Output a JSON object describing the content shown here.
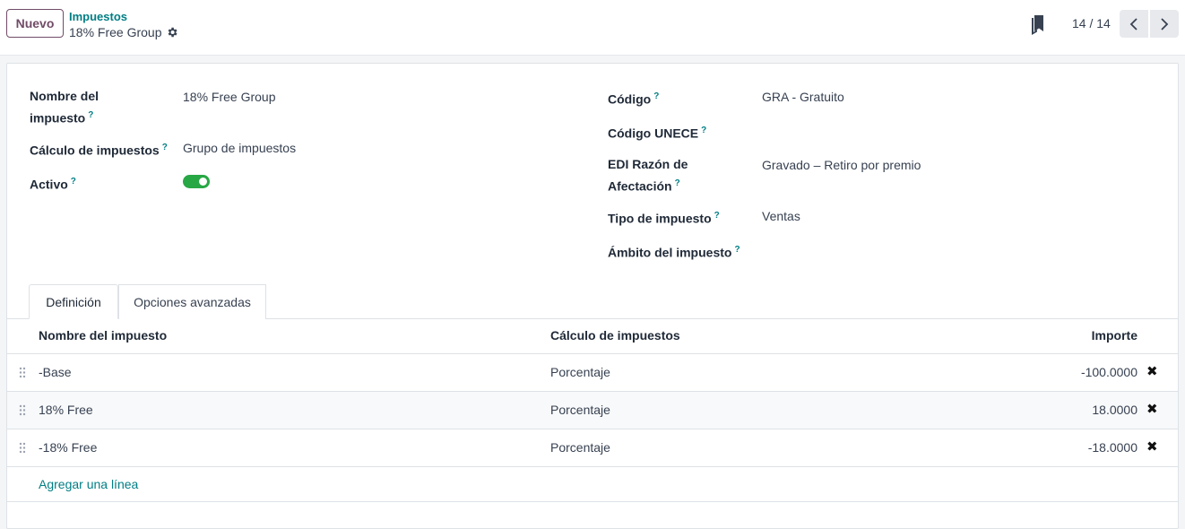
{
  "control_panel": {
    "new_button": "Nuevo",
    "breadcrumb_parent": "Impuestos",
    "breadcrumb_current": "18% Free Group",
    "pager": "14 / 14"
  },
  "form": {
    "left": {
      "tax_name_label_1": "Nombre del",
      "tax_name_label_2": "impuesto",
      "tax_name_value": "18% Free Group",
      "tax_computation_label": "Cálculo de impuestos",
      "tax_computation_value": "Grupo de impuestos",
      "active_label": "Activo",
      "active_value": true
    },
    "right": {
      "code_label": "Código",
      "code_value": "GRA - Gratuito",
      "unece_label": "Código UNECE",
      "edi_label_1": "EDI Razón de",
      "edi_label_2": "Afectación",
      "edi_value": "Gravado – Retiro por premio",
      "tax_type_label": "Tipo de impuesto",
      "tax_type_value": "Ventas",
      "tax_scope_label": "Ámbito del impuesto"
    },
    "help_mark": "?"
  },
  "tabs": [
    {
      "label": "Definición",
      "active": true
    },
    {
      "label": "Opciones avanzadas",
      "active": false
    }
  ],
  "table": {
    "headers": {
      "name": "Nombre del impuesto",
      "computation": "Cálculo de impuestos",
      "amount": "Importe"
    },
    "rows": [
      {
        "name": "-Base",
        "computation": "Porcentaje",
        "amount": "-100.0000"
      },
      {
        "name": "18% Free",
        "computation": "Porcentaje",
        "amount": "18.0000"
      },
      {
        "name": "-18% Free",
        "computation": "Porcentaje",
        "amount": "-18.0000"
      }
    ],
    "add_line": "Agregar una línea",
    "delete_icon": "✖"
  },
  "colors": {
    "primary": "#714b67",
    "link": "#017e84",
    "toggle_on": "#28a745"
  }
}
